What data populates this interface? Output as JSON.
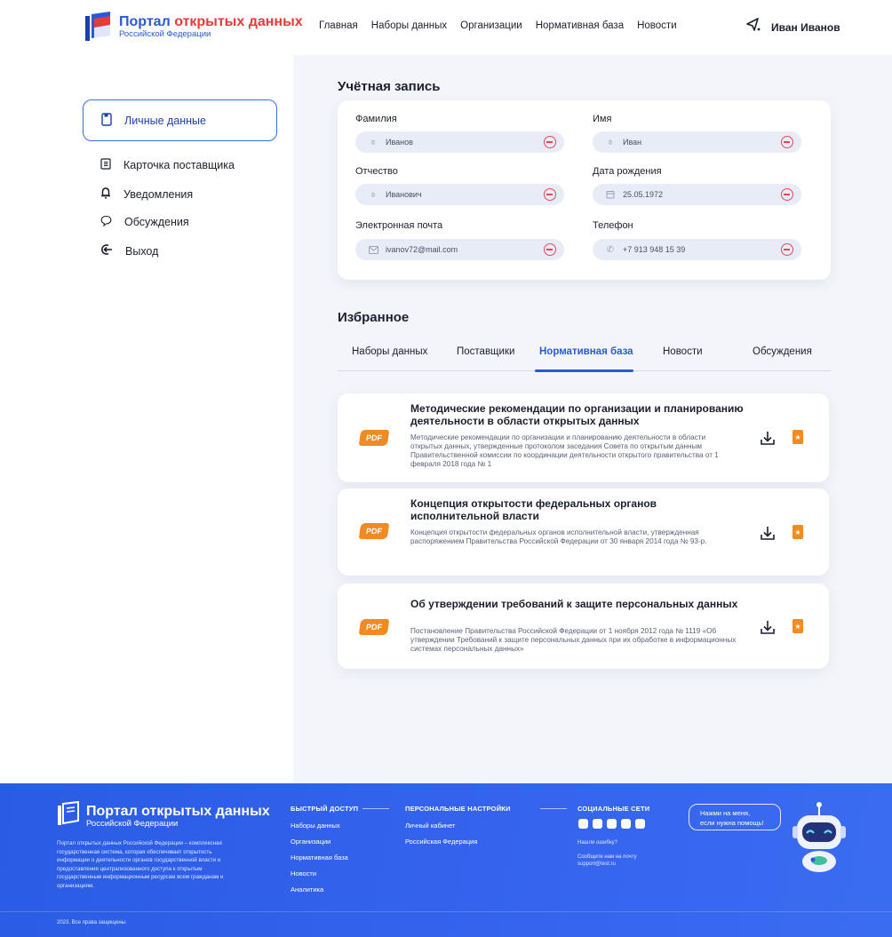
{
  "header": {
    "logo": {
      "title_main": "Портал ",
      "title_accent": "открытых данных",
      "subtitle": "Российской Федерации"
    },
    "nav": [
      "Главная",
      "Наборы данных",
      "Организации",
      "Нормативная база",
      "Новости"
    ],
    "user_name": "Иван Иванов"
  },
  "sidebar": {
    "items": [
      {
        "label": "Личные данные",
        "icon": "document-icon",
        "active": true
      },
      {
        "label": "Карточка поставщика",
        "icon": "card-icon"
      },
      {
        "label": "Уведомления",
        "icon": "bell-icon"
      },
      {
        "label": "Обсуждения",
        "icon": "chat-icon"
      },
      {
        "label": "Выход",
        "icon": "logout-icon"
      }
    ]
  },
  "account": {
    "title": "Учётная запись",
    "fields": [
      {
        "label": "Фамилия",
        "value": "Иванов",
        "icon": "person-icon"
      },
      {
        "label": "Имя",
        "value": "Иван",
        "icon": "person-icon"
      },
      {
        "label": "Отчество",
        "value": "Иванович",
        "icon": "person-icon"
      },
      {
        "label": "Дата рождения",
        "value": "25.05.1972",
        "icon": "calendar-icon"
      },
      {
        "label": "Электронная почта",
        "value": "ivanov72@mail.com",
        "icon": "mail-icon"
      },
      {
        "label": "Телефон",
        "value": "+7 913 948 15 39",
        "icon": "phone-icon"
      }
    ]
  },
  "favorites": {
    "title": "Избранное",
    "tabs": [
      "Наборы данных",
      "Поставщики",
      "Нормативная база",
      "Новости",
      "Обсуждения"
    ],
    "active_tab": "Нормативная база",
    "pdf_label": "PDF",
    "docs": [
      {
        "title": "Методические рекомендации по организации и планированию деятельности в области открытых данных",
        "description": "Методические рекомендации по организации и планированию деятельности в области открытых данных, утвержденные протоколом заседания Совета по открытым данным Правительственной комиссии по координации деятельности открытого правительства от 1 февраля 2018 года № 1"
      },
      {
        "title": "Концепция открытости федеральных органов исполнительной власти",
        "description": "Концепция открытости федеральных органов исполнительной власти, утвержденная распоряжением Правительства Российской Федерации от 30 января 2014 года № 93-р."
      },
      {
        "title": "Об утверждении требований к защите персональных данных",
        "description": "Постановление Правительства Российской Федерации от 1 ноября 2012 года № 1119 «Об утверждении Требований к защите персональных данных при их обработке в информационных системах персональных данных»"
      }
    ]
  },
  "footer": {
    "logo": {
      "title": "Портал открытых данных",
      "subtitle": "Российской Федерации"
    },
    "description": "Портал открытых данных Российской Федерации – комплексная государственная система, которая обеспечивает открытость информации о деятельности органов государственной власти и предоставления централизованного доступа к открытым государственным информационным ресурсам всем гражданам и организациям.",
    "quick_access": {
      "title": "БЫСТРЫЙ ДОСТУП",
      "links": [
        "Наборы данных",
        "Организации",
        "Нормативная база",
        "Новости",
        "Аналитика"
      ]
    },
    "personal": {
      "title": "ПЕРСОНАЛЬНЫЕ НАСТРОЙКИ",
      "links": [
        "Личный кабинет",
        "Российская Федерация"
      ]
    },
    "social": {
      "title": "СОЦИАЛЬНЫЕ СЕТИ",
      "found_error": "Нашли ошибку?",
      "contact_line1": "Сообщите нам на почту",
      "contact_line2": "support@test.ru"
    },
    "help_bubble": {
      "line1": "Нажми на меня,",
      "line2": "если нужна помощь!"
    },
    "copyright": "2023. Все права защищены."
  },
  "colors": {
    "accent": "#2a59d6",
    "brand_red": "#e43b3b",
    "pdf_orange": "#f08a24",
    "footer_blue": "#3563ee"
  }
}
